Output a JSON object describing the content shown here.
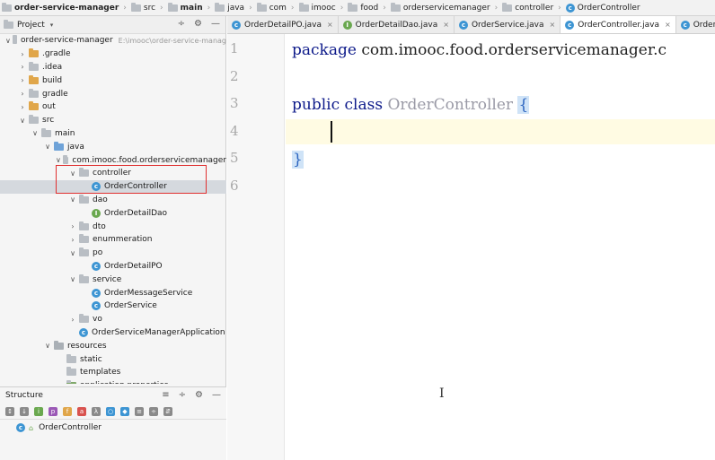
{
  "breadcrumb": [
    {
      "label": "order-service-manager",
      "icon": "folder-icon",
      "bold": true
    },
    {
      "label": "src",
      "icon": "folder-icon",
      "bold": false
    },
    {
      "label": "main",
      "icon": "folder-icon",
      "bold": true
    },
    {
      "label": "java",
      "icon": "folder-icon",
      "bold": false
    },
    {
      "label": "com",
      "icon": "folder-icon",
      "bold": false
    },
    {
      "label": "imooc",
      "icon": "folder-icon",
      "bold": false
    },
    {
      "label": "food",
      "icon": "folder-icon",
      "bold": false
    },
    {
      "label": "orderservicemanager",
      "icon": "folder-icon",
      "bold": false
    },
    {
      "label": "controller",
      "icon": "folder-icon",
      "bold": false
    },
    {
      "label": "OrderController",
      "icon": "class-icon",
      "bold": false
    }
  ],
  "project_panel": {
    "title": "Project",
    "tree": [
      {
        "label": "order-service-manager",
        "hint": "E:\\imooc\\order-service-manag",
        "indent": 0,
        "arrow": "down",
        "icon": "module"
      },
      {
        "label": ".gradle",
        "indent": 1,
        "arrow": "right",
        "icon": "orange"
      },
      {
        "label": ".idea",
        "indent": 1,
        "arrow": "right",
        "icon": "grey"
      },
      {
        "label": "build",
        "indent": 1,
        "arrow": "right",
        "icon": "orange"
      },
      {
        "label": "gradle",
        "indent": 1,
        "arrow": "right",
        "icon": "grey"
      },
      {
        "label": "out",
        "indent": 1,
        "arrow": "right",
        "icon": "orange"
      },
      {
        "label": "src",
        "indent": 1,
        "arrow": "down",
        "icon": "grey"
      },
      {
        "label": "main",
        "indent": 2,
        "arrow": "down",
        "icon": "grey"
      },
      {
        "label": "java",
        "indent": 3,
        "arrow": "down",
        "icon": "blue"
      },
      {
        "label": "com.imooc.food.orderservicemanager",
        "indent": 4,
        "arrow": "down",
        "icon": "grey"
      },
      {
        "label": "controller",
        "indent": 5,
        "arrow": "down",
        "icon": "grey"
      },
      {
        "label": "OrderController",
        "indent": 6,
        "arrow": "",
        "icon": "class",
        "selected": true
      },
      {
        "label": "dao",
        "indent": 5,
        "arrow": "down",
        "icon": "grey"
      },
      {
        "label": "OrderDetailDao",
        "indent": 6,
        "arrow": "",
        "icon": "interface"
      },
      {
        "label": "dto",
        "indent": 5,
        "arrow": "right",
        "icon": "grey"
      },
      {
        "label": "enummeration",
        "indent": 5,
        "arrow": "right",
        "icon": "grey"
      },
      {
        "label": "po",
        "indent": 5,
        "arrow": "down",
        "icon": "grey"
      },
      {
        "label": "OrderDetailPO",
        "indent": 6,
        "arrow": "",
        "icon": "class"
      },
      {
        "label": "service",
        "indent": 5,
        "arrow": "down",
        "icon": "grey"
      },
      {
        "label": "OrderMessageService",
        "indent": 6,
        "arrow": "",
        "icon": "class"
      },
      {
        "label": "OrderService",
        "indent": 6,
        "arrow": "",
        "icon": "class"
      },
      {
        "label": "vo",
        "indent": 5,
        "arrow": "right",
        "icon": "grey"
      },
      {
        "label": "OrderServiceManagerApplication",
        "indent": 5,
        "arrow": "",
        "icon": "class"
      },
      {
        "label": "resources",
        "indent": 3,
        "arrow": "down",
        "icon": "res"
      },
      {
        "label": "static",
        "indent": 4,
        "arrow": "",
        "icon": "grey"
      },
      {
        "label": "templates",
        "indent": 4,
        "arrow": "",
        "icon": "grey"
      },
      {
        "label": "application.properties",
        "indent": 4,
        "arrow": "",
        "icon": "props"
      }
    ]
  },
  "structure_panel": {
    "title": "Structure",
    "item": "OrderController"
  },
  "tabs": [
    {
      "label": "OrderDetailPO.java",
      "icon": "class",
      "active": false
    },
    {
      "label": "OrderDetailDao.java",
      "icon": "interface",
      "active": false
    },
    {
      "label": "OrderService.java",
      "icon": "class",
      "active": false
    },
    {
      "label": "OrderController.java",
      "icon": "class",
      "active": true
    },
    {
      "label": "OrderMessageSe",
      "icon": "class",
      "active": false
    }
  ],
  "editor": {
    "line_numbers": [
      "1",
      "2",
      "3",
      "4",
      "5",
      "6"
    ],
    "line1": {
      "kw": "package",
      "rest": " com.imooc.food.orderservicemanager.c"
    },
    "line3": {
      "kw": "public class",
      "name": "OrderController",
      "brace": "{"
    },
    "line5": {
      "brace": "}"
    }
  },
  "colors": {
    "keyword": "#0d1a8a",
    "highlight_box": "#e03030",
    "selection": "#d5d9de"
  }
}
